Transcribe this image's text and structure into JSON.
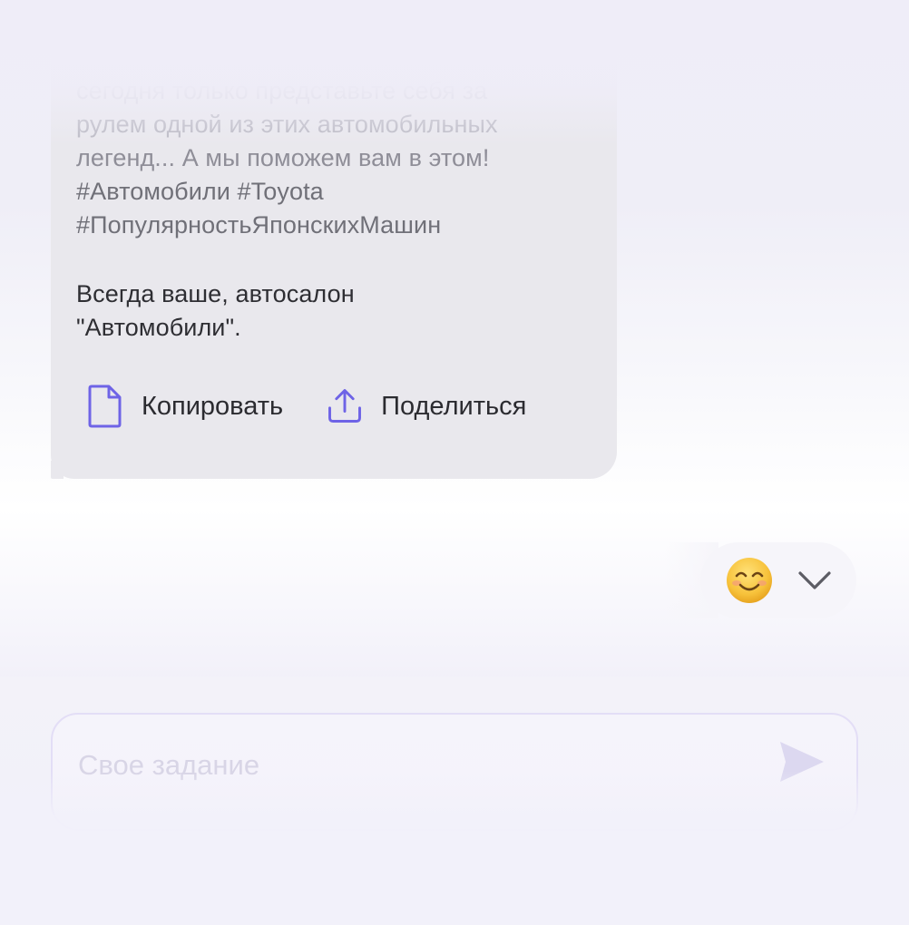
{
  "message": {
    "lines": [
      "сегодня только представьте себя за",
      "рулем одной из этих автомобильных",
      "легенд... А мы поможем вам в этом!",
      "#Автомобили #Toyota",
      "#ПопулярностьЯпонскихМашин",
      "Всегда ваше, автосалон",
      "\"Автомобили\"."
    ],
    "actions": {
      "copy_label": "Копировать",
      "share_label": "Поделиться"
    }
  },
  "reaction": {
    "emoji": "😊",
    "icon": "chevron-down-icon"
  },
  "composer": {
    "placeholder": "Свое задание"
  },
  "colors": {
    "accent": "#6e63e6",
    "bubble": "#e9e8ed",
    "send_icon": "#dcd8f0"
  }
}
